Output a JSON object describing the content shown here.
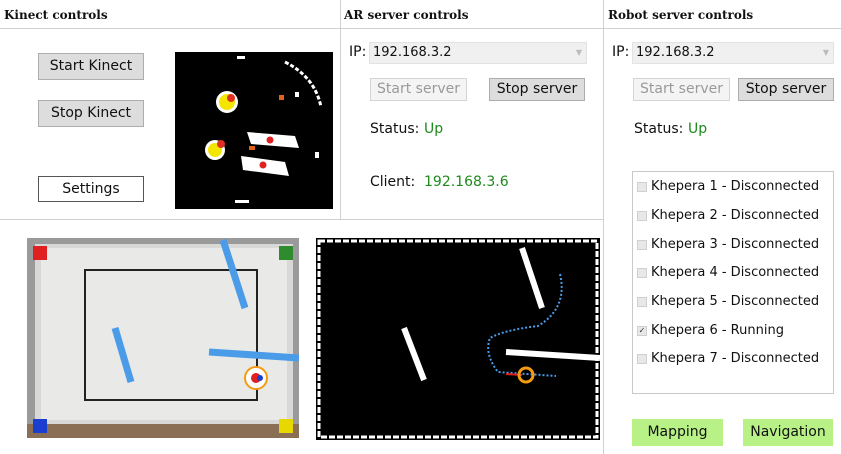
{
  "panels": {
    "kinect": {
      "title": "Kinect controls",
      "start_label": "Start Kinect",
      "stop_label": "Stop Kinect",
      "settings_label": "Settings"
    },
    "ar_server": {
      "title": "AR server controls",
      "ip_label": "IP:",
      "ip_value": "192.168.3.2",
      "start_label": "Start server",
      "stop_label": "Stop server",
      "status_label": "Status:",
      "status_value": "Up",
      "client_label": "Client:",
      "client_value": "192.168.3.6"
    },
    "robot_server": {
      "title": "Robot server controls",
      "ip_label": "IP:",
      "ip_value": "192.168.3.2",
      "start_label": "Start server",
      "stop_label": "Stop server",
      "status_label": "Status:",
      "status_value": "Up",
      "robots": [
        {
          "label": "Khepera 1 - Disconnected",
          "checked": false
        },
        {
          "label": "Khepera 2 - Disconnected",
          "checked": false
        },
        {
          "label": "Khepera 3 - Disconnected",
          "checked": false
        },
        {
          "label": "Khepera 4 - Disconnected",
          "checked": false
        },
        {
          "label": "Khepera 5 - Disconnected",
          "checked": false
        },
        {
          "label": "Khepera 6 - Running",
          "checked": true
        },
        {
          "label": "Khepera 7 - Disconnected",
          "checked": false
        }
      ],
      "mapping_label": "Mapping",
      "navigation_label": "Navigation"
    }
  },
  "colors": {
    "status_green": "#1d8a1d",
    "action_button_green": "#b8f286",
    "wall_blue": "#4a9be8",
    "marker_red": "#e02020",
    "marker_green": "#2e8b2e",
    "marker_blue": "#1a3fd0",
    "marker_yellow": "#e6d800",
    "robot_orange": "#f39c12"
  }
}
